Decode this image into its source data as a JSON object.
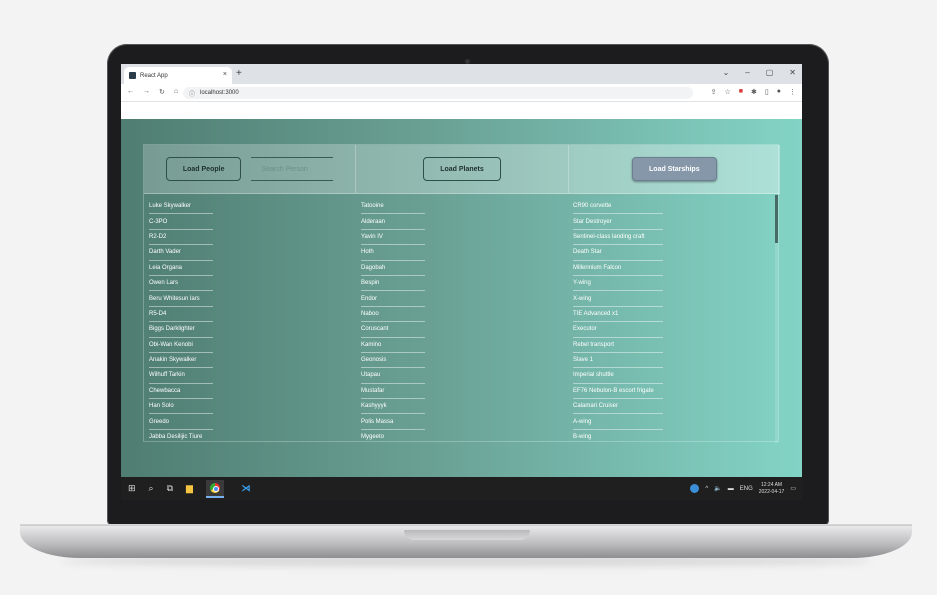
{
  "browser": {
    "tab_title": "React App",
    "tab_close": "×",
    "new_tab": "+",
    "url": "localhost:3000",
    "window_controls": [
      "⌄",
      "–",
      "▢",
      "✕"
    ]
  },
  "header": {
    "load_people": "Load People",
    "search_placeholder": "Search Person",
    "load_planets": "Load Planets",
    "load_starships": "Load Starships"
  },
  "people": [
    "Luke Skywalker",
    "C-3PO",
    "R2-D2",
    "Darth Vader",
    "Leia Organa",
    "Owen Lars",
    "Beru Whitesun lars",
    "R5-D4",
    "Biggs Darklighter",
    "Obi-Wan Kenobi",
    "Anakin Skywalker",
    "Wilhuff Tarkin",
    "Chewbacca",
    "Han Solo",
    "Greedo",
    "Jabba Desilijic Tiure"
  ],
  "planets": [
    "Tatooine",
    "Alderaan",
    "Yavin IV",
    "Hoth",
    "Dagobah",
    "Bespin",
    "Endor",
    "Naboo",
    "Coruscant",
    "Kamino",
    "Geonosis",
    "Utapau",
    "Mustafar",
    "Kashyyyk",
    "Polis Massa",
    "Mygeeto"
  ],
  "starships": [
    "CR90 corvette",
    "Star Destroyer",
    "Sentinel-class landing craft",
    "Death Star",
    "Millennium Falcon",
    "Y-wing",
    "X-wing",
    "TIE Advanced x1",
    "Executor",
    "Rebel transport",
    "Slave 1",
    "Imperial shuttle",
    "EF76 Nebulon-B escort frigate",
    "Calamari Cruiser",
    "A-wing",
    "B-wing"
  ],
  "taskbar": {
    "lang": "ENG",
    "time": "12:24 AM",
    "date": "2022-04-17"
  },
  "colors": {
    "gradient_start": "#4f7d72",
    "gradient_end": "#83d4c6",
    "active_button": "#8597a8"
  }
}
